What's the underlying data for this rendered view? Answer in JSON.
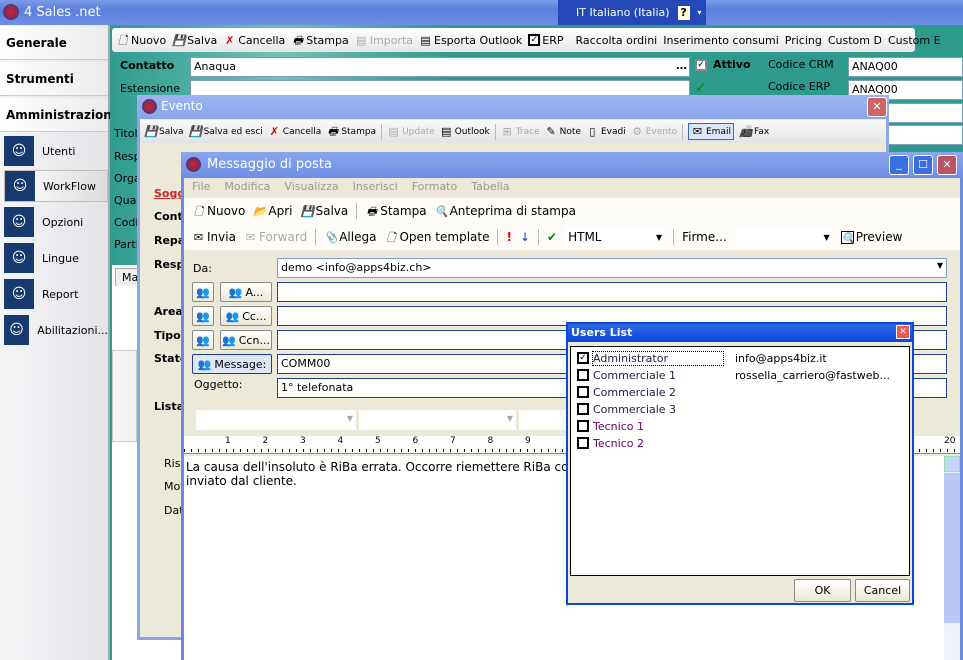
{
  "app": {
    "title": "4 Sales .net",
    "language": "IT Italiano (Italia)",
    "help_icon": "help-icon"
  },
  "sidebar": {
    "sections": [
      "Generale",
      "Strumenti",
      "Amministrazione"
    ],
    "items": [
      {
        "label": "Utenti",
        "icon": "users-icon"
      },
      {
        "label": "WorkFlow",
        "icon": "workflow-icon"
      },
      {
        "label": "Opzioni",
        "icon": "options-icon"
      },
      {
        "label": "Lingue",
        "icon": "languages-icon"
      },
      {
        "label": "Report",
        "icon": "report-icon"
      },
      {
        "label": "Abilitazioni...",
        "icon": "permissions-icon"
      }
    ],
    "selected": "WorkFlow"
  },
  "main_toolbar": {
    "nuovo": "Nuovo",
    "salva": "Salva",
    "cancella": "Cancella",
    "stampa": "Stampa",
    "importa": "Importa",
    "esporta": "Esporta Outlook",
    "erp": "ERP",
    "raccolta": "Raccolta ordini",
    "inserimento": "Inserimento consumi",
    "pricing": "Pricing",
    "custom_d": "Custom D",
    "custom_e": "Custom E"
  },
  "contact": {
    "contatto_label": "Contatto",
    "contatto_value": "Anaqua",
    "estensione_label": "Estensione",
    "attivo_label": "Attivo",
    "crm_label": "Codice CRM",
    "crm_value": "ANAQ00",
    "erp_label": "Codice ERP",
    "erp_value": "ANAQ00",
    "side_labels": [
      "Titol",
      "Resp",
      "Orga",
      "Qual",
      "Codi",
      "Parti"
    ],
    "tab": "Ma"
  },
  "evento": {
    "title": "Evento",
    "toolbar": {
      "salva": "Salva",
      "salva_esci": "Salva ed esci",
      "cancella": "Cancella",
      "stampa": "Stampa",
      "update": "Update",
      "outlook": "Outlook",
      "trace": "Trace",
      "note": "Note",
      "evadi": "Evadi",
      "evento": "Evento",
      "email": "Email",
      "fax": "Fax"
    },
    "labels": [
      "Sogg",
      "Conta",
      "Repa",
      "Resp",
      "Area",
      "Tipo",
      "Stato",
      "Lista",
      "Risc",
      "Moti",
      "Dat"
    ]
  },
  "messaggio": {
    "title": "Messaggio di posta",
    "menu": [
      "File",
      "Modifica",
      "Visualizza",
      "Inserisci",
      "Formato",
      "Tabella"
    ],
    "toolbar1": {
      "nuovo": "Nuovo",
      "apri": "Apri",
      "salva": "Salva",
      "stampa": "Stampa",
      "anteprima": "Anteprima di stampa"
    },
    "toolbar2": {
      "invia": "Invia",
      "forward": "Forward",
      "allega": "Allega",
      "open_template": "Open template",
      "format": "HTML",
      "firme": "Firme...",
      "firme_value": "",
      "preview": "Preview"
    },
    "da_label": "Da:",
    "da_value": "demo <info@apps4biz.ch>",
    "a_label": "A...",
    "a_value": "",
    "cc_label": "Cc...",
    "cc_value": "",
    "ccn_label": "Ccn...",
    "ccn_value": "",
    "message_label": "Message:",
    "message_value": "COMM00",
    "oggetto_label": "Oggetto:",
    "oggetto_value": "1° telefonata",
    "ruler": [
      "1",
      "2",
      "3",
      "4",
      "5",
      "6",
      "7",
      "8",
      "9",
      "20"
    ],
    "body_line1": "La causa dell'insoluto è RiBa errata. Occorre riemettere RiBa con",
    "body_line2": "inviato dal cliente."
  },
  "users_list": {
    "title": "Users List",
    "ok": "OK",
    "cancel": "Cancel",
    "users": [
      {
        "name": "Administrator",
        "email": "info@apps4biz.it",
        "checked": true
      },
      {
        "name": "Commerciale 1",
        "email": "rossella_carriero@fastweb...",
        "checked": false
      },
      {
        "name": "Commerciale 2",
        "email": "",
        "checked": false
      },
      {
        "name": "Commerciale 3",
        "email": "",
        "checked": false
      },
      {
        "name": "Tecnico 1",
        "email": "",
        "checked": false
      },
      {
        "name": "Tecnico 2",
        "email": "",
        "checked": false
      }
    ]
  },
  "colors": {
    "title_bar": "#5b7fdc",
    "main_bg": "#2e9a8e",
    "dialog_bg": "#ece9d8"
  }
}
